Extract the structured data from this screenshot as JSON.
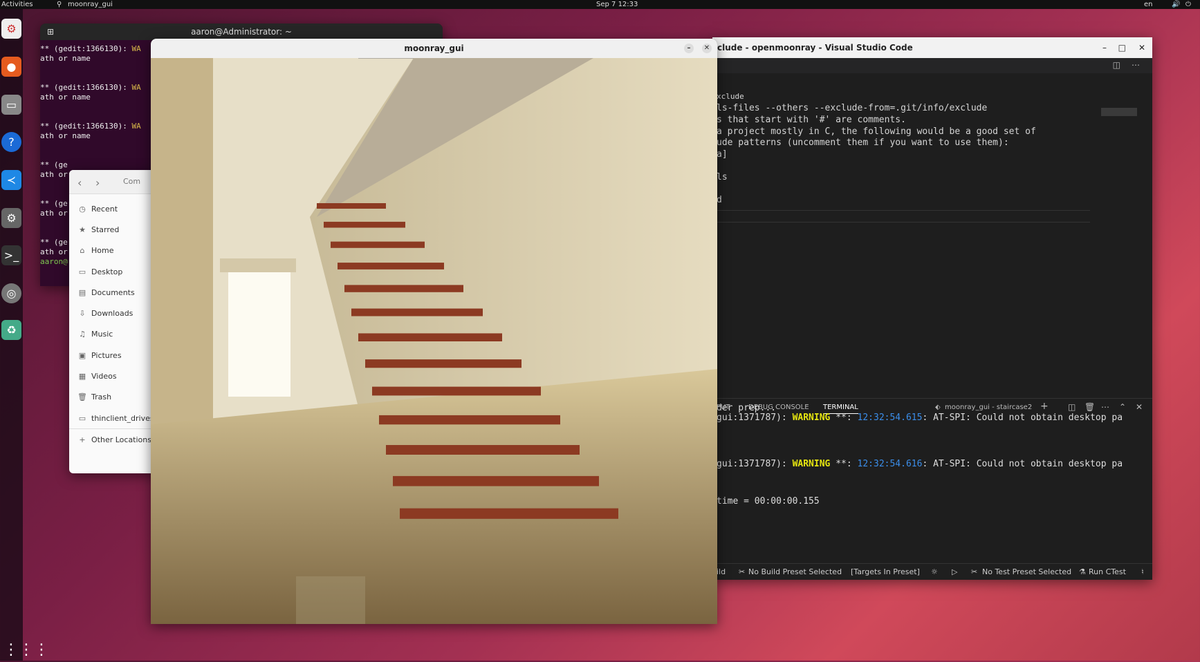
{
  "topbar": {
    "activities": "Activities",
    "app": "moonray_gui",
    "clock": "Sep 7  12:33",
    "lang": "en"
  },
  "terminal": {
    "title": "aaron@Administrator: ~",
    "lines": [
      {
        "a": "** (gedit:1366130): ",
        "b": "WA"
      },
      {
        "a": "ath or name",
        "b": ""
      },
      {
        "a": "",
        "b": ""
      },
      {
        "a": "",
        "b": ""
      },
      {
        "a": "** (gedit:1366130): ",
        "b": "WA"
      },
      {
        "a": "ath or name",
        "b": ""
      },
      {
        "a": "",
        "b": ""
      },
      {
        "a": "",
        "b": ""
      },
      {
        "a": "** (gedit:1366130): ",
        "b": "WA"
      },
      {
        "a": "ath or name",
        "b": ""
      },
      {
        "a": "",
        "b": ""
      },
      {
        "a": "",
        "b": ""
      },
      {
        "a": "** (ge",
        "b": ""
      },
      {
        "a": "ath or",
        "b": ""
      },
      {
        "a": "",
        "b": ""
      },
      {
        "a": "",
        "b": ""
      },
      {
        "a": "** (ge",
        "b": ""
      },
      {
        "a": "ath or",
        "b": ""
      },
      {
        "a": "",
        "b": ""
      },
      {
        "a": "",
        "b": ""
      },
      {
        "a": "** (ge",
        "b": ""
      },
      {
        "a": "ath or",
        "b": ""
      },
      {
        "a": "aaron@",
        "b": ""
      }
    ]
  },
  "files": {
    "path": "Com",
    "items": [
      {
        "icon": "clock-icon",
        "glyph": "◷",
        "label": "Recent"
      },
      {
        "icon": "star-icon",
        "glyph": "★",
        "label": "Starred"
      },
      {
        "icon": "home-icon",
        "glyph": "⌂",
        "label": "Home"
      },
      {
        "icon": "desktop-icon",
        "glyph": "▭",
        "label": "Desktop"
      },
      {
        "icon": "document-icon",
        "glyph": "▤",
        "label": "Documents"
      },
      {
        "icon": "download-icon",
        "glyph": "⇩",
        "label": "Downloads"
      },
      {
        "icon": "music-icon",
        "glyph": "♫",
        "label": "Music"
      },
      {
        "icon": "pictures-icon",
        "glyph": "▣",
        "label": "Pictures"
      },
      {
        "icon": "videos-icon",
        "glyph": "▦",
        "label": "Videos"
      },
      {
        "icon": "trash-icon",
        "glyph": "🗑",
        "label": "Trash"
      },
      {
        "icon": "drive-icon",
        "glyph": "▭",
        "label": "thinclient_drives"
      },
      {
        "icon": "plus-icon",
        "glyph": "+",
        "label": "Other Locations"
      }
    ]
  },
  "moonray": {
    "title": "moonray_gui"
  },
  "vscode": {
    "title": "clude - openmoonray - Visual Studio Code",
    "code": [
      "xclude",
      "ls-files --others --exclude-from=.git/info/exclude",
      "s that start with '#' are comments.",
      "a project mostly in C, the following would be a good set of",
      "ude patterns (uncomment them if you want to use them):",
      "a]",
      "",
      "ls",
      "",
      "d"
    ],
    "panel_tabs": [
      "PUT",
      "DEBUG CONSOLE",
      "TERMINAL"
    ],
    "terminal_name": "moonray_gui - staircase2",
    "term_lines": [
      {
        "pre": "der prep...",
        "warn": "",
        "mid": "",
        "time": "",
        "post": ""
      },
      {
        "pre": "gui:1371787): ",
        "warn": "WARNING",
        "mid": " **: ",
        "time": "12:32:54.615",
        "post": ": AT-SPI: Could not obtain desktop pa"
      },
      {
        "pre": "gui:1371787): ",
        "warn": "WARNING",
        "mid": " **: ",
        "time": "12:32:54.616",
        "post": ": AT-SPI: Could not obtain desktop pa"
      },
      {
        "pre": "time = 00:00:00.155",
        "warn": "",
        "mid": "",
        "time": "",
        "post": ""
      }
    ],
    "status": {
      "build": "ild",
      "build_preset": "No Build Preset Selected",
      "targets": "[Targets In Preset]",
      "test_preset": "No Test Preset Selected",
      "ctest": "Run CTest"
    },
    "colors": {
      "warning": "#e5e510",
      "timestamp": "#3b8eea"
    }
  }
}
